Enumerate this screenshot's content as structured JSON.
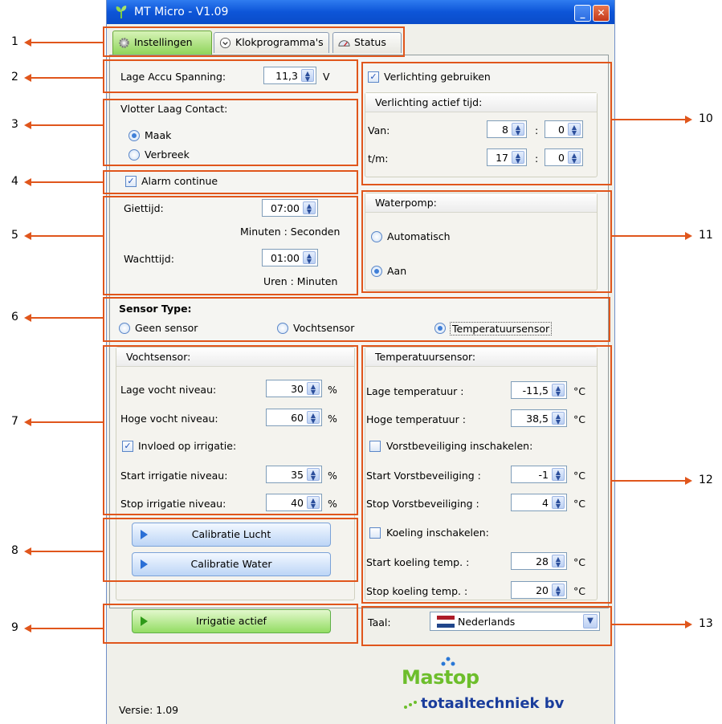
{
  "window": {
    "title": "MT Micro - V1.09"
  },
  "tabs": [
    {
      "label": "Instellingen",
      "active": true
    },
    {
      "label": "Klokprogramma's",
      "active": false
    },
    {
      "label": "Status",
      "active": false
    }
  ],
  "accu": {
    "label": "Lage Accu Spanning:",
    "value": "11,3",
    "unit": "V"
  },
  "vlotter": {
    "title": "Vlotter Laag Contact:",
    "options": [
      "Maak",
      "Verbreek"
    ],
    "selected": "Maak"
  },
  "alarm": {
    "label": "Alarm continue",
    "checked": true
  },
  "timers": {
    "giettijd_label": "Giettijd:",
    "giettijd_value": "07:00",
    "giettijd_units": "Minuten : Seconden",
    "wachttijd_label": "Wachttijd:",
    "wachttijd_value": "01:00",
    "wachttijd_units": "Uren : Minuten"
  },
  "sensor_type": {
    "title": "Sensor Type:",
    "options": [
      "Geen sensor",
      "Vochtsensor",
      "Temperatuursensor"
    ],
    "selected": "Temperatuursensor"
  },
  "vocht": {
    "title": "Vochtsensor:",
    "lage_label": "Lage vocht niveau:",
    "lage_value": "30",
    "hoge_label": "Hoge vocht niveau:",
    "hoge_value": "60",
    "invloed_label": "Invloed op irrigatie:",
    "start_label": "Start irrigatie niveau:",
    "start_value": "35",
    "stop_label": "Stop irrigatie niveau:",
    "stop_value": "40",
    "unit": "%"
  },
  "calibratie": {
    "lucht": "Calibratie Lucht",
    "water": "Calibratie Water"
  },
  "irrigatie": {
    "label": "Irrigatie actief"
  },
  "verlichting": {
    "use_label": "Verlichting gebruiken",
    "group_title": "Verlichting actief tijd:",
    "van_label": "Van:",
    "van_hour": "8",
    "van_min": "0",
    "tm_label": "t/m:",
    "tm_hour": "17",
    "tm_min": "0",
    "sep": ":"
  },
  "waterpomp": {
    "title": "Waterpomp:",
    "options": [
      "Automatisch",
      "Aan"
    ],
    "selected": "Aan"
  },
  "temp": {
    "title": "Temperatuursensor:",
    "lage_label": "Lage temperatuur :",
    "lage_value": "-11,5",
    "hoge_label": "Hoge temperatuur :",
    "hoge_value": "38,5",
    "vorst_label": "Vorstbeveiliging inschakelen:",
    "start_vorst_label": "Start Vorstbeveiliging :",
    "start_vorst_value": "-1",
    "stop_vorst_label": "Stop Vorstbeveiliging :",
    "stop_vorst_value": "4",
    "koeling_label": "Koeling inschakelen:",
    "start_koel_label": "Start koeling temp. :",
    "start_koel_value": "28",
    "stop_koel_label": "Stop koeling temp. :",
    "stop_koel_value": "20",
    "unit": "°C"
  },
  "taal": {
    "label": "Taal:",
    "value": "Nederlands"
  },
  "footer": {
    "version": "Versie: 1.09",
    "logo_top": "Mastop",
    "logo_bottom": "totaaltechniek bv"
  },
  "annotations": [
    "1",
    "2",
    "3",
    "4",
    "5",
    "6",
    "7",
    "8",
    "9",
    "10",
    "11",
    "12",
    "13"
  ],
  "colors": {
    "accent": "#e0561c",
    "titlebar": "#0d55d8",
    "logo_green": "#6dbe2c",
    "logo_blue": "#1a3d9c"
  }
}
